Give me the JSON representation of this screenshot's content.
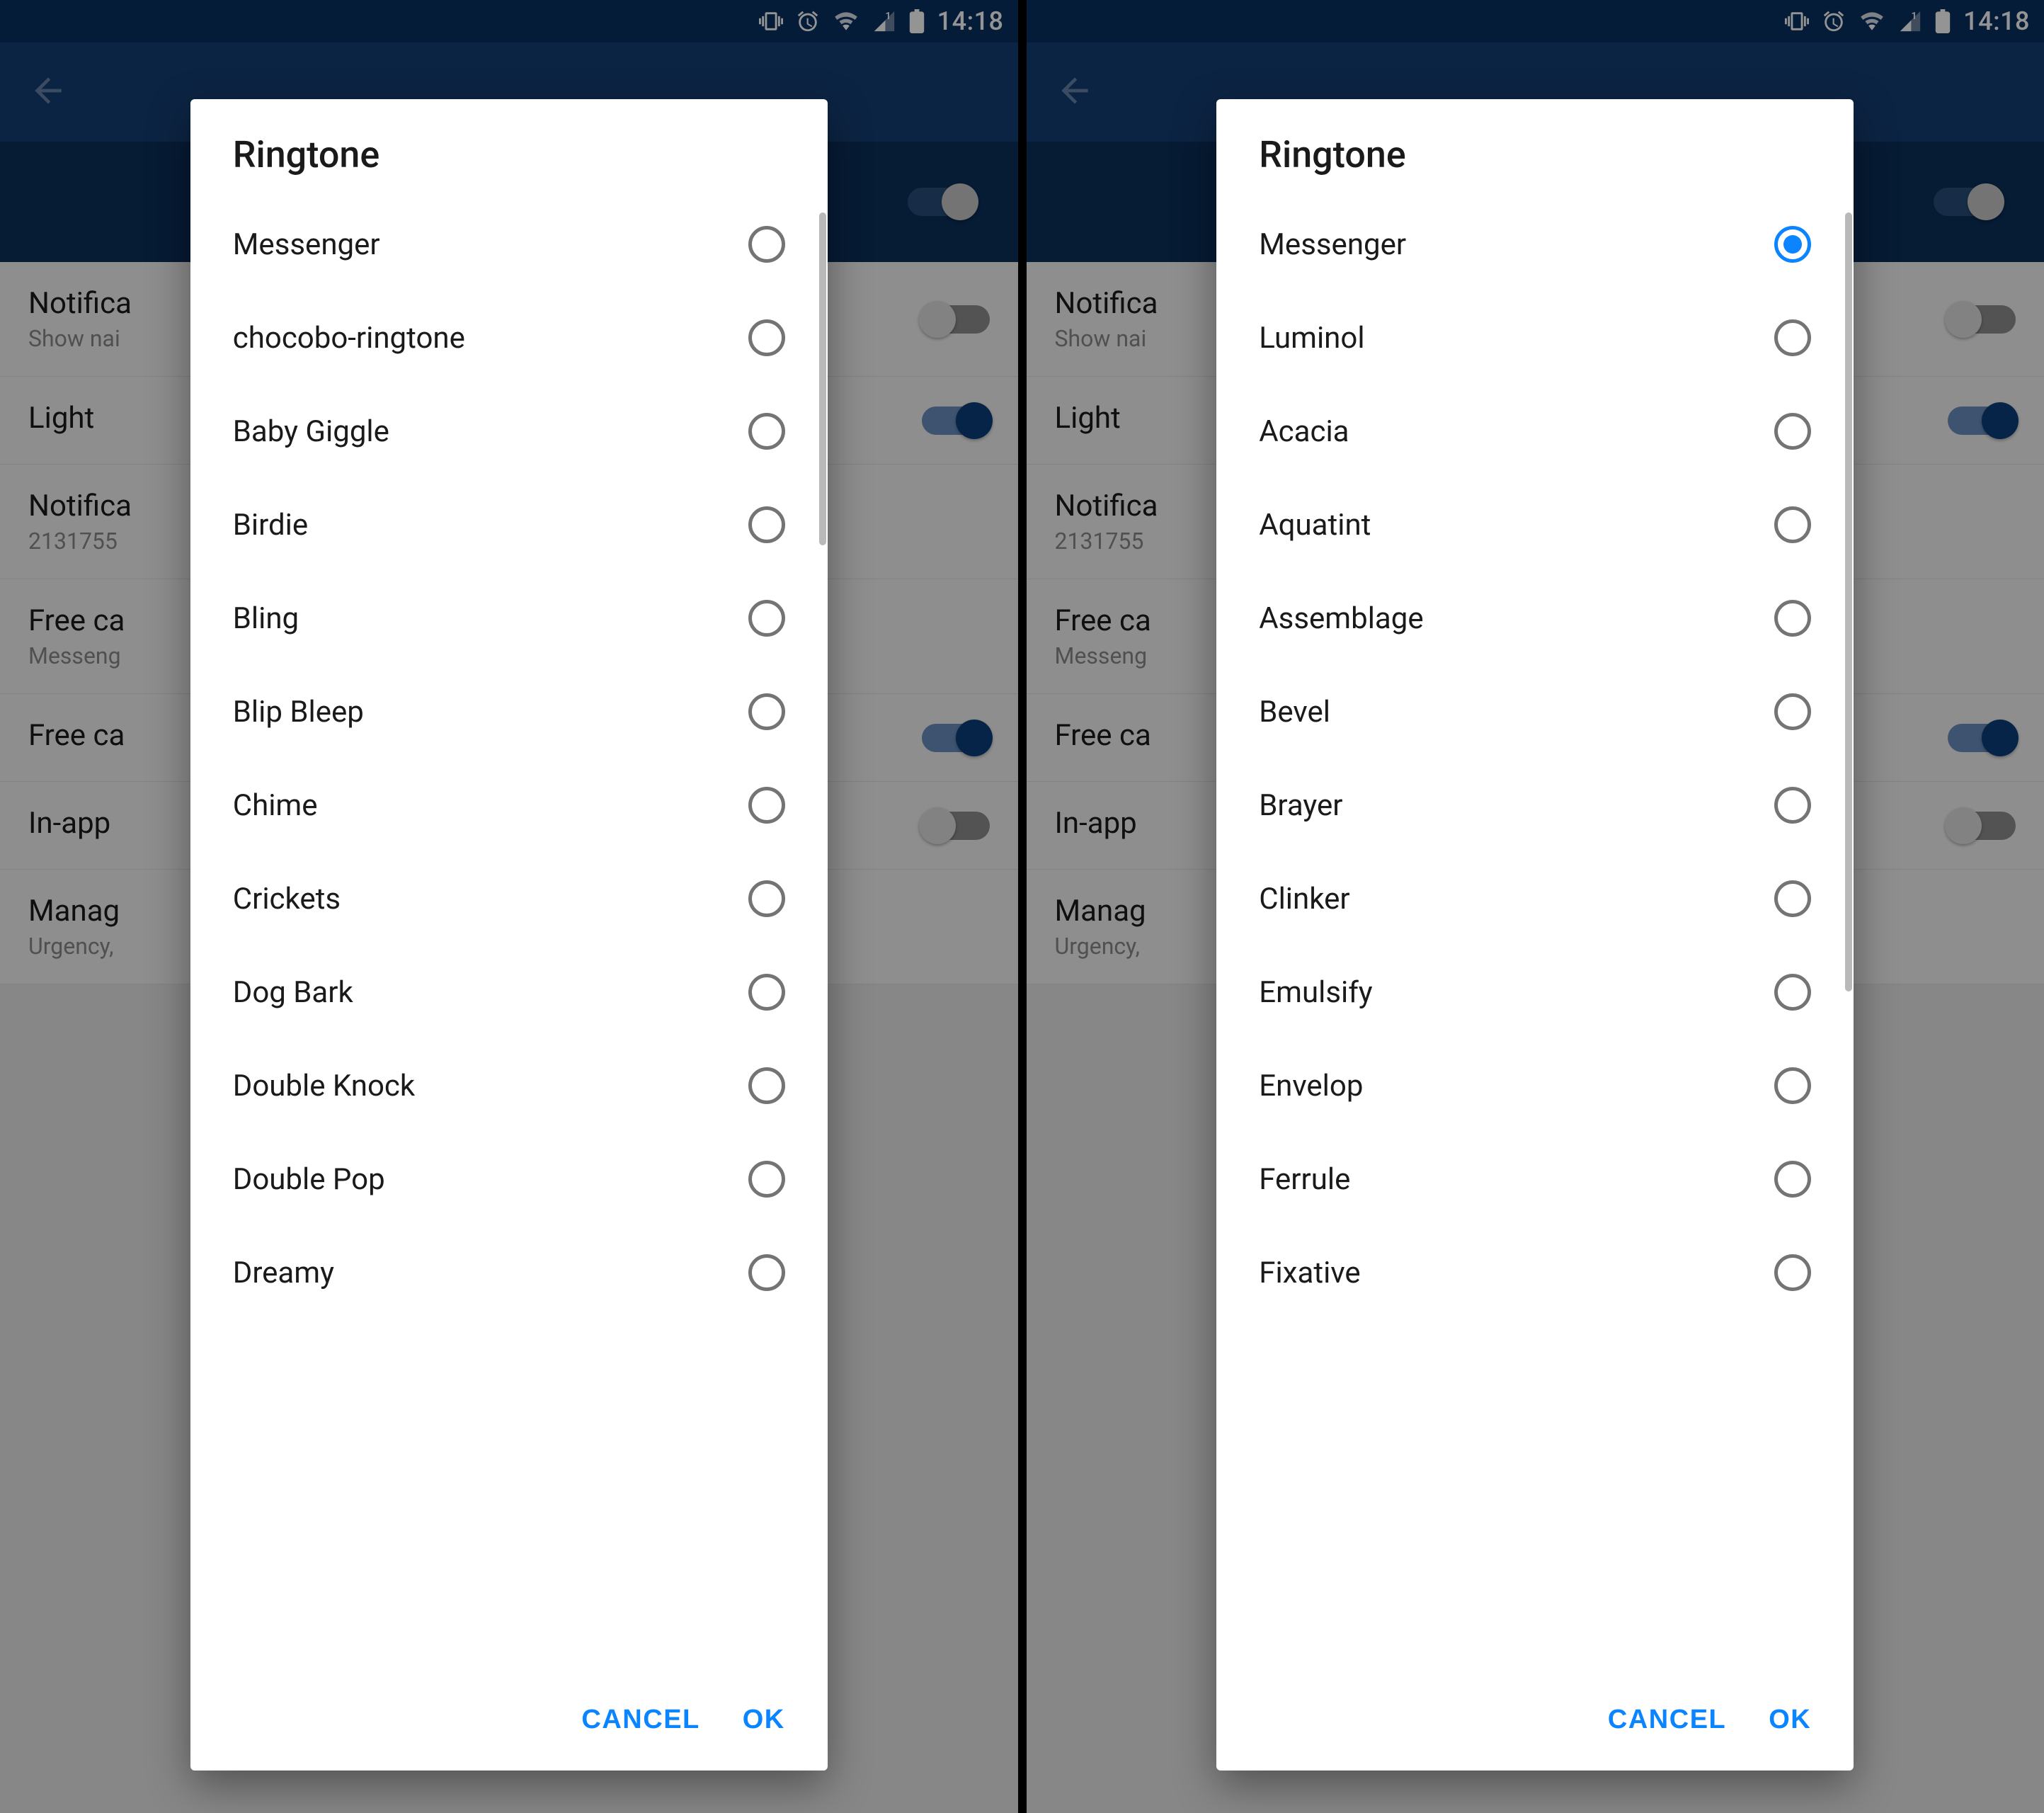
{
  "status": {
    "time": "14:18"
  },
  "settings_bg": [
    {
      "title": "Notifica",
      "sub": "Show nai",
      "toggle": "off"
    },
    {
      "title": "Light",
      "sub": "",
      "toggle": "on"
    },
    {
      "title": "Notifica",
      "sub": "2131755",
      "toggle": null
    },
    {
      "title": "Free ca",
      "sub": "Messeng",
      "toggle": null
    },
    {
      "title": "Free ca",
      "sub": "",
      "toggle": "on"
    },
    {
      "title": "In-app",
      "sub": "",
      "toggle": "off"
    },
    {
      "title": "Manag",
      "sub": "Urgency,",
      "toggle": null
    }
  ],
  "dialog": {
    "title": "Ringtone",
    "cancel": "CANCEL",
    "ok": "OK"
  },
  "left": {
    "selected_index": -1,
    "options": [
      "Messenger",
      "chocobo-ringtone",
      "Baby Giggle",
      "Birdie",
      "Bling",
      "Blip Bleep",
      "Chime",
      "Crickets",
      "Dog Bark",
      "Double Knock",
      "Double Pop",
      "Dreamy"
    ]
  },
  "right": {
    "selected_index": 0,
    "options": [
      "Messenger",
      "Luminol",
      "Acacia",
      "Aquatint",
      "Assemblage",
      "Bevel",
      "Brayer",
      "Clinker",
      "Emulsify",
      "Envelop",
      "Ferrule",
      "Fixative"
    ]
  }
}
